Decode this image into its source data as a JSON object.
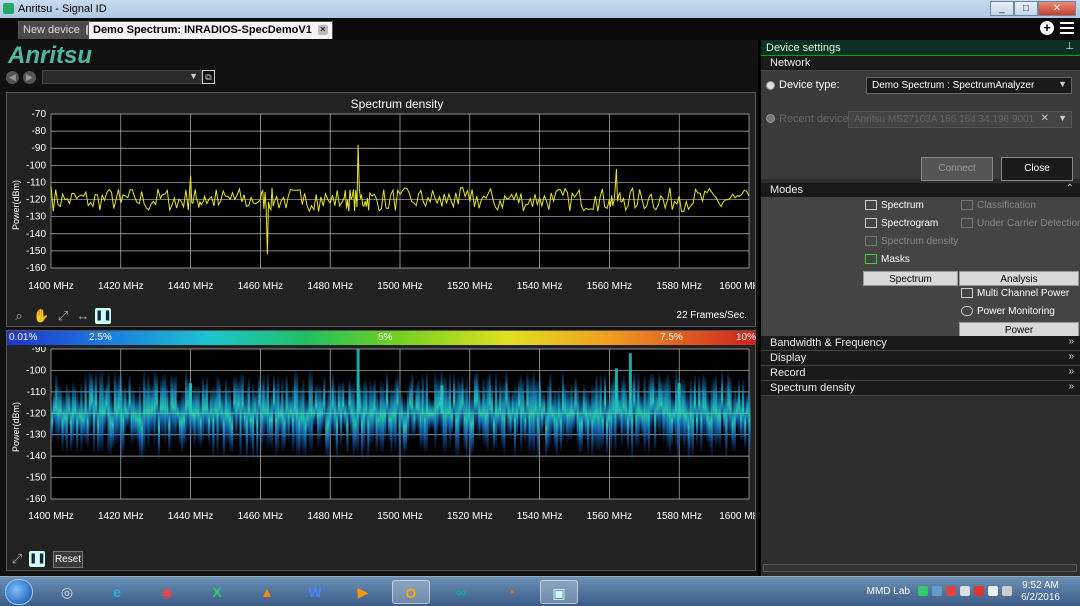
{
  "window": {
    "title": "Anritsu - Signal ID",
    "minimize": "_",
    "maximize": "□",
    "close": "✕"
  },
  "tabs": [
    {
      "label": "New device",
      "close": "✕"
    },
    {
      "label": "Demo Spectrum: INRADIOS-SpecDemoV1",
      "close": "✕"
    }
  ],
  "toolbar": {
    "plus": "+"
  },
  "logo": "Anritsu",
  "nav": {
    "back": "◀",
    "forward": "▶",
    "select_arrow": "▼",
    "doc": "⧉"
  },
  "spectrum_panel": {
    "fps": "22 Frames/Sec."
  },
  "spectrogram_panel": {
    "colorbar_labels": [
      "0.01%",
      "2.5%",
      "5%",
      "7.5%",
      "10%"
    ],
    "reset": "Reset"
  },
  "chart_data": [
    {
      "type": "line",
      "title": "Spectrum density",
      "ylabel": "Power(dBm)",
      "xlabel": "",
      "xlim": [
        1400,
        1600
      ],
      "ylim": [
        -160,
        -70
      ],
      "xticks": [
        "1400 MHz",
        "1420 MHz",
        "1440 MHz",
        "1460 MHz",
        "1480 MHz",
        "1500 MHz",
        "1520 MHz",
        "1540 MHz",
        "1560 MHz",
        "1580 MHz",
        "1600 MHz"
      ],
      "yticks": [
        -70,
        -80,
        -90,
        -100,
        -110,
        -120,
        -130,
        -140,
        -150,
        -160
      ],
      "grid": true,
      "color": "#e6e62a",
      "x": [
        1400,
        1404,
        1408,
        1412,
        1416,
        1420,
        1424,
        1428,
        1432,
        1436,
        1440,
        1442,
        1444,
        1448,
        1452,
        1456,
        1460,
        1462,
        1464,
        1468,
        1472,
        1476,
        1480,
        1484,
        1486,
        1488,
        1490,
        1492,
        1496,
        1500,
        1504,
        1508,
        1512,
        1516,
        1520,
        1524,
        1528,
        1532,
        1536,
        1540,
        1544,
        1548,
        1552,
        1556,
        1560,
        1562,
        1564,
        1568,
        1572,
        1576,
        1580,
        1584,
        1588,
        1592,
        1596,
        1600
      ],
      "y": [
        -112,
        -120,
        -118,
        -124,
        -116,
        -122,
        -119,
        -126,
        -117,
        -125,
        -106,
        -121,
        -118,
        -123,
        -116,
        -124,
        -120,
        -152,
        -121,
        -118,
        -123,
        -117,
        -122,
        -119,
        -120,
        -88,
        -121,
        -118,
        -125,
        -117,
        -122,
        -119,
        -124,
        -116,
        -121,
        -118,
        -126,
        -117,
        -123,
        -119,
        -121,
        -116,
        -124,
        -118,
        -120,
        -102,
        -119,
        -123,
        -117,
        -125,
        -118,
        -122,
        -116,
        -124,
        -119,
        -118
      ]
    },
    {
      "type": "heatmap",
      "ylabel": "Power(dBm)",
      "xlabel": "",
      "xlim": [
        1400,
        1600
      ],
      "ylim": [
        -160,
        -90
      ],
      "xticks": [
        "1400 MHz",
        "1420 MHz",
        "1440 MHz",
        "1460 MHz",
        "1480 MHz",
        "1500 MHz",
        "1520 MHz",
        "1540 MHz",
        "1560 MHz",
        "1580 MHz",
        "1600 MHz"
      ],
      "yticks": [
        -90,
        -100,
        -110,
        -120,
        -130,
        -140,
        -150,
        -160
      ],
      "grid": true,
      "peaks_mhz": [
        1440,
        1488,
        1512,
        1562,
        1566,
        1580
      ],
      "peak_levels_dbm": [
        -106,
        -90,
        -107,
        -99,
        -92,
        -106
      ],
      "noise_floor_dbm": -120
    }
  ],
  "right_panel": {
    "title": "Device settings",
    "pin": "📌",
    "network": {
      "header": "Network",
      "device_type_label": "Device type:",
      "device_type_value": "Demo Spectrum : SpectrumAnalyzer",
      "recent_devices_label": "Recent devices:",
      "recent_devices_value": "Anritsu MS27103A  166.164.34.196:9001",
      "connect": "Connect",
      "close": "Close"
    },
    "modes": {
      "header": "Modes",
      "spectrum_items": [
        "Spectrum",
        "Spectrogram",
        "Spectrum density",
        "Masks"
      ],
      "spectrum_group": "Spectrum",
      "analysis_items": [
        "Classification",
        "Under Carrier Detection"
      ],
      "analysis_group": "Analysis",
      "power_items": [
        "Multi Channel Power",
        "Power Monitoring"
      ],
      "power_group": "Power"
    },
    "sections": [
      "Bandwidth & Frequency",
      "Display",
      "Record",
      "Spectrum density"
    ]
  },
  "taskbar": {
    "network": "MMD Lab",
    "time": "9:52 AM",
    "date": "6/2/2016"
  }
}
